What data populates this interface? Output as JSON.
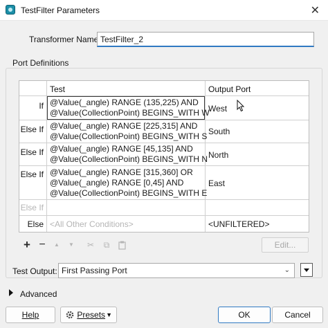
{
  "window": {
    "title": "TestFilter Parameters"
  },
  "transformer_name": {
    "label": "Transformer Name:",
    "value": "TestFilter_2"
  },
  "port_definitions": {
    "group_label": "Port Definitions",
    "headers": {
      "test": "Test",
      "output_port": "Output Port"
    },
    "rows": [
      {
        "condition": "If",
        "test_line1": "@Value(_angle) RANGE (135,225) AND",
        "test_line2": "@Value(CollectionPoint) BEGINS_WITH W",
        "test_line3": "",
        "port": "West"
      },
      {
        "condition": "Else If",
        "test_line1": "@Value(_angle) RANGE [225,315] AND",
        "test_line2": "@Value(CollectionPoint) BEGINS_WITH S",
        "test_line3": "",
        "port": "South"
      },
      {
        "condition": "Else If",
        "test_line1": "@Value(_angle) RANGE [45,135] AND",
        "test_line2": "@Value(CollectionPoint) BEGINS_WITH N",
        "test_line3": "",
        "port": "North"
      },
      {
        "condition": "Else If",
        "test_line1": "@Value(_angle) RANGE [315,360] OR",
        "test_line2": "@Value(_angle) RANGE [0,45] AND",
        "test_line3": "@Value(CollectionPoint) BEGINS_WITH E",
        "port": "East"
      },
      {
        "condition": "Else If",
        "test_line1": "",
        "test_line2": "",
        "test_line3": "",
        "port": ""
      },
      {
        "condition": "Else",
        "test_line1": "<All Other Conditions>",
        "test_line2": "",
        "test_line3": "",
        "port": "<UNFILTERED>"
      }
    ],
    "toolbar": {
      "add": "+",
      "remove": "−",
      "up": "▲",
      "down": "▼",
      "cut": "✂",
      "copy": "⧉",
      "paste": "📋",
      "edit_label": "Edit..."
    }
  },
  "test_output": {
    "label": "Test Output:",
    "value": "First Passing Port"
  },
  "advanced": {
    "label": "Advanced"
  },
  "buttons": {
    "help": "Help",
    "presets": "Presets",
    "ok": "OK",
    "cancel": "Cancel"
  },
  "icons": {
    "app": "fme-app-icon",
    "close": "close-icon",
    "presets": "gear-icon"
  },
  "colors": {
    "focus_blue": "#2f79c2",
    "disabled_text": "#b5b5b5"
  }
}
